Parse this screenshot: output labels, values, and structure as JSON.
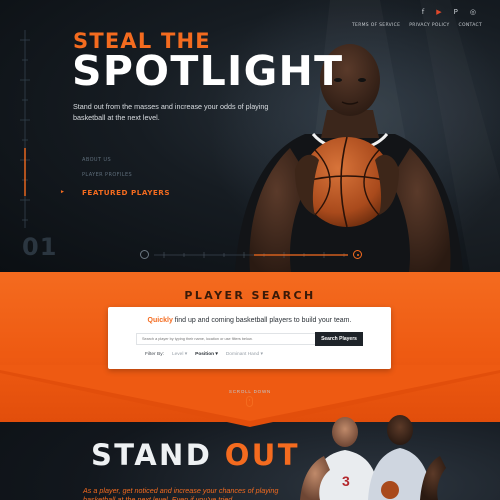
{
  "colors": {
    "accent": "#f46b1f",
    "dark": "#0d1116",
    "white": "#ffffff"
  },
  "social": [
    {
      "icon": "facebook-icon",
      "glyph": "f"
    },
    {
      "icon": "youtube-icon",
      "glyph": "▶"
    },
    {
      "icon": "pinterest-icon",
      "glyph": "P"
    },
    {
      "icon": "instagram-icon",
      "glyph": "◎"
    }
  ],
  "top_links": [
    "TERMS OF SERVICE",
    "PRIVACY POLICY",
    "CONTACT"
  ],
  "hero": {
    "kicker": "STEAL THE",
    "headline": "SPOTLIGHT",
    "lede": "Stand out from the masses and increase your odds of playing basketball at the next level.",
    "steps": [
      {
        "label": "ABOUT US",
        "active": false
      },
      {
        "label": "PLAYER PROFILES",
        "active": false
      },
      {
        "label": "FEATURED PLAYERS",
        "active": true
      }
    ],
    "slide_number": "01"
  },
  "search": {
    "title": "PLAYER SEARCH",
    "card_lead": "Quickly",
    "card_rest": " find up and coming basketball players to build your team.",
    "placeholder": "Search a player by typing their name, location or use filters below.",
    "button": "Search Players",
    "filter_label": "Filter By:",
    "filters": [
      "Level ▾",
      "Position ▾",
      "Dominant Hand ▾"
    ]
  },
  "scroll_label": "SCROLL DOWN",
  "stand_out": {
    "word1": "STAND",
    "word2": "OUT",
    "copy": "As a player, get noticed and increase your chances of playing basketball at the next level. Even if you've tried"
  }
}
